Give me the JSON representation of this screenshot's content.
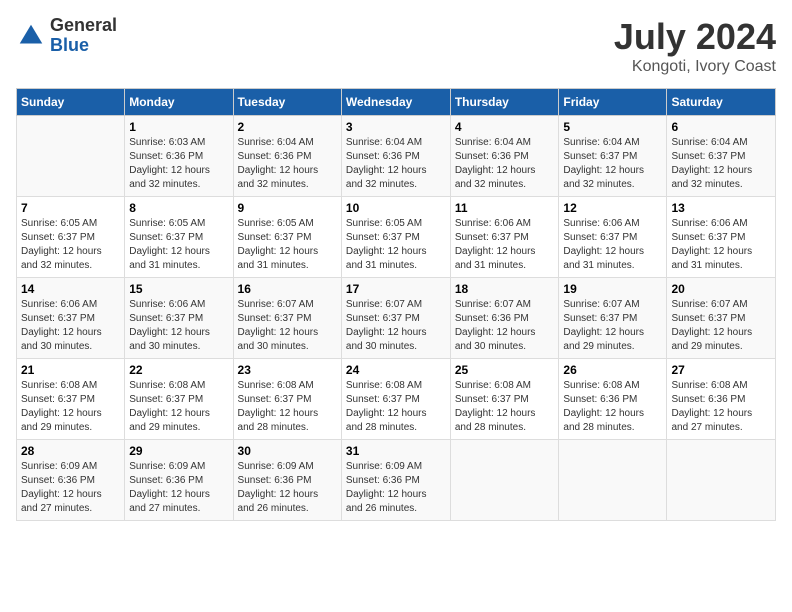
{
  "header": {
    "logo_general": "General",
    "logo_blue": "Blue",
    "month_title": "July 2024",
    "location": "Kongoti, Ivory Coast"
  },
  "weekdays": [
    "Sunday",
    "Monday",
    "Tuesday",
    "Wednesday",
    "Thursday",
    "Friday",
    "Saturday"
  ],
  "weeks": [
    [
      {
        "day": "",
        "info": ""
      },
      {
        "day": "1",
        "info": "Sunrise: 6:03 AM\nSunset: 6:36 PM\nDaylight: 12 hours\nand 32 minutes."
      },
      {
        "day": "2",
        "info": "Sunrise: 6:04 AM\nSunset: 6:36 PM\nDaylight: 12 hours\nand 32 minutes."
      },
      {
        "day": "3",
        "info": "Sunrise: 6:04 AM\nSunset: 6:36 PM\nDaylight: 12 hours\nand 32 minutes."
      },
      {
        "day": "4",
        "info": "Sunrise: 6:04 AM\nSunset: 6:36 PM\nDaylight: 12 hours\nand 32 minutes."
      },
      {
        "day": "5",
        "info": "Sunrise: 6:04 AM\nSunset: 6:37 PM\nDaylight: 12 hours\nand 32 minutes."
      },
      {
        "day": "6",
        "info": "Sunrise: 6:04 AM\nSunset: 6:37 PM\nDaylight: 12 hours\nand 32 minutes."
      }
    ],
    [
      {
        "day": "7",
        "info": "Sunrise: 6:05 AM\nSunset: 6:37 PM\nDaylight: 12 hours\nand 32 minutes."
      },
      {
        "day": "8",
        "info": "Sunrise: 6:05 AM\nSunset: 6:37 PM\nDaylight: 12 hours\nand 31 minutes."
      },
      {
        "day": "9",
        "info": "Sunrise: 6:05 AM\nSunset: 6:37 PM\nDaylight: 12 hours\nand 31 minutes."
      },
      {
        "day": "10",
        "info": "Sunrise: 6:05 AM\nSunset: 6:37 PM\nDaylight: 12 hours\nand 31 minutes."
      },
      {
        "day": "11",
        "info": "Sunrise: 6:06 AM\nSunset: 6:37 PM\nDaylight: 12 hours\nand 31 minutes."
      },
      {
        "day": "12",
        "info": "Sunrise: 6:06 AM\nSunset: 6:37 PM\nDaylight: 12 hours\nand 31 minutes."
      },
      {
        "day": "13",
        "info": "Sunrise: 6:06 AM\nSunset: 6:37 PM\nDaylight: 12 hours\nand 31 minutes."
      }
    ],
    [
      {
        "day": "14",
        "info": "Sunrise: 6:06 AM\nSunset: 6:37 PM\nDaylight: 12 hours\nand 30 minutes."
      },
      {
        "day": "15",
        "info": "Sunrise: 6:06 AM\nSunset: 6:37 PM\nDaylight: 12 hours\nand 30 minutes."
      },
      {
        "day": "16",
        "info": "Sunrise: 6:07 AM\nSunset: 6:37 PM\nDaylight: 12 hours\nand 30 minutes."
      },
      {
        "day": "17",
        "info": "Sunrise: 6:07 AM\nSunset: 6:37 PM\nDaylight: 12 hours\nand 30 minutes."
      },
      {
        "day": "18",
        "info": "Sunrise: 6:07 AM\nSunset: 6:36 PM\nDaylight: 12 hours\nand 30 minutes."
      },
      {
        "day": "19",
        "info": "Sunrise: 6:07 AM\nSunset: 6:37 PM\nDaylight: 12 hours\nand 29 minutes."
      },
      {
        "day": "20",
        "info": "Sunrise: 6:07 AM\nSunset: 6:37 PM\nDaylight: 12 hours\nand 29 minutes."
      }
    ],
    [
      {
        "day": "21",
        "info": "Sunrise: 6:08 AM\nSunset: 6:37 PM\nDaylight: 12 hours\nand 29 minutes."
      },
      {
        "day": "22",
        "info": "Sunrise: 6:08 AM\nSunset: 6:37 PM\nDaylight: 12 hours\nand 29 minutes."
      },
      {
        "day": "23",
        "info": "Sunrise: 6:08 AM\nSunset: 6:37 PM\nDaylight: 12 hours\nand 28 minutes."
      },
      {
        "day": "24",
        "info": "Sunrise: 6:08 AM\nSunset: 6:37 PM\nDaylight: 12 hours\nand 28 minutes."
      },
      {
        "day": "25",
        "info": "Sunrise: 6:08 AM\nSunset: 6:37 PM\nDaylight: 12 hours\nand 28 minutes."
      },
      {
        "day": "26",
        "info": "Sunrise: 6:08 AM\nSunset: 6:36 PM\nDaylight: 12 hours\nand 28 minutes."
      },
      {
        "day": "27",
        "info": "Sunrise: 6:08 AM\nSunset: 6:36 PM\nDaylight: 12 hours\nand 27 minutes."
      }
    ],
    [
      {
        "day": "28",
        "info": "Sunrise: 6:09 AM\nSunset: 6:36 PM\nDaylight: 12 hours\nand 27 minutes."
      },
      {
        "day": "29",
        "info": "Sunrise: 6:09 AM\nSunset: 6:36 PM\nDaylight: 12 hours\nand 27 minutes."
      },
      {
        "day": "30",
        "info": "Sunrise: 6:09 AM\nSunset: 6:36 PM\nDaylight: 12 hours\nand 26 minutes."
      },
      {
        "day": "31",
        "info": "Sunrise: 6:09 AM\nSunset: 6:36 PM\nDaylight: 12 hours\nand 26 minutes."
      },
      {
        "day": "",
        "info": ""
      },
      {
        "day": "",
        "info": ""
      },
      {
        "day": "",
        "info": ""
      }
    ]
  ]
}
